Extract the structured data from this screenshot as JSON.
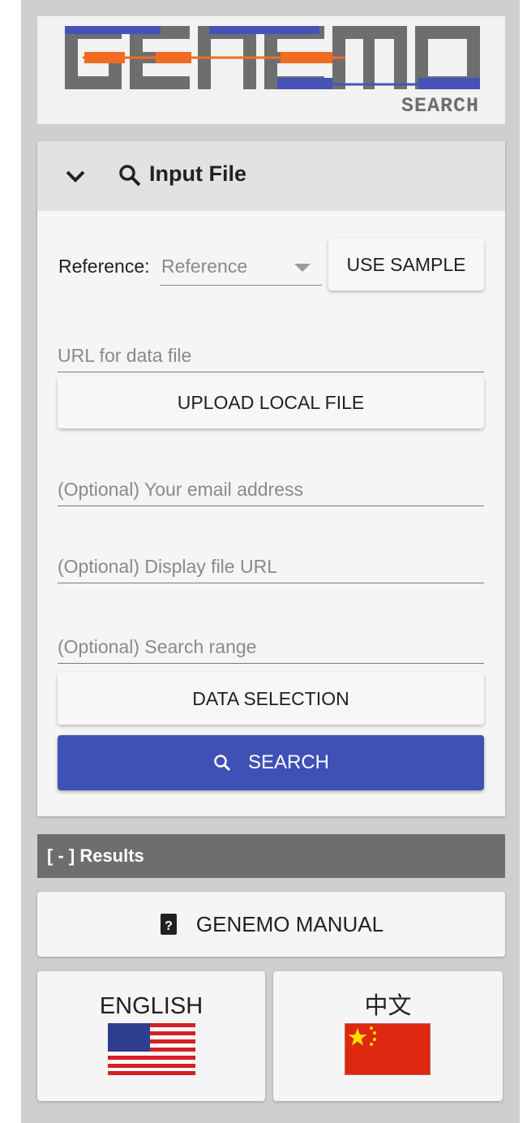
{
  "logo": {
    "wordmark": "GENEMO",
    "subtitle": "SEARCH",
    "colors": {
      "gray": "#6e6e6e",
      "blue": "#4652b8",
      "orange": "#f26b22"
    }
  },
  "input_panel": {
    "title": "Input File",
    "expanded_icon": "chevron-down-icon",
    "title_icon": "search-icon",
    "reference": {
      "label": "Reference:",
      "placeholder": "Reference"
    },
    "use_sample_label": "USE SAMPLE",
    "url_field": {
      "placeholder": "URL for data file",
      "value": ""
    },
    "upload_label": "UPLOAD LOCAL FILE",
    "email_field": {
      "placeholder": "(Optional) Your email address",
      "value": ""
    },
    "display_url_field": {
      "placeholder": "(Optional) Display file URL",
      "value": ""
    },
    "search_range_field": {
      "placeholder": "(Optional) Search range",
      "value": ""
    },
    "data_selection_label": "DATA SELECTION",
    "search_label": "SEARCH",
    "accent_color": "#3f51b5"
  },
  "results": {
    "label": "[ - ] Results"
  },
  "manual": {
    "label": "GENEMO MANUAL",
    "icon": "book-help-icon"
  },
  "languages": [
    {
      "label": "ENGLISH",
      "flag": "us-flag-icon"
    },
    {
      "label": "中文",
      "flag": "china-flag-icon"
    }
  ]
}
